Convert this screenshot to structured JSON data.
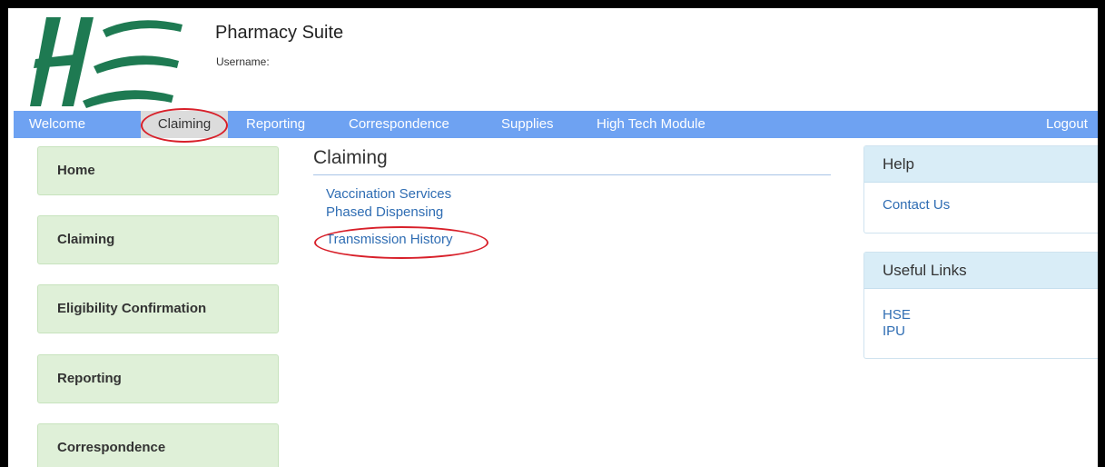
{
  "header": {
    "app_title": "Pharmacy Suite",
    "username_label": "Username:"
  },
  "nav": {
    "items": [
      {
        "label": "Welcome"
      },
      {
        "label": "Claiming",
        "active": true
      },
      {
        "label": "Reporting"
      },
      {
        "label": "Correspondence"
      },
      {
        "label": "Supplies"
      },
      {
        "label": "High Tech Module"
      }
    ],
    "logout": "Logout"
  },
  "sidebar": {
    "items": [
      {
        "label": "Home"
      },
      {
        "label": "Claiming"
      },
      {
        "label": "Eligibility Confirmation"
      },
      {
        "label": "Reporting"
      },
      {
        "label": "Correspondence"
      }
    ]
  },
  "main": {
    "title": "Claiming",
    "links": [
      {
        "label": "Vaccination Services"
      },
      {
        "label": "Phased Dispensing"
      },
      {
        "label": "Transmission History"
      }
    ]
  },
  "help_panel": {
    "title": "Help",
    "links": [
      {
        "label": "Contact Us"
      }
    ]
  },
  "useful_links_panel": {
    "title": "Useful Links",
    "links": [
      {
        "label": "HSE"
      },
      {
        "label": "IPU"
      }
    ]
  },
  "colors": {
    "nav_bar": "#6ea2f2",
    "sidebar_button": "#dff0d8",
    "panel_header": "#d9edf7",
    "link": "#2f6db3",
    "annotation": "#d8202a",
    "logo_green": "#1e7a52"
  },
  "icons": {
    "logo": "hse-logo"
  }
}
